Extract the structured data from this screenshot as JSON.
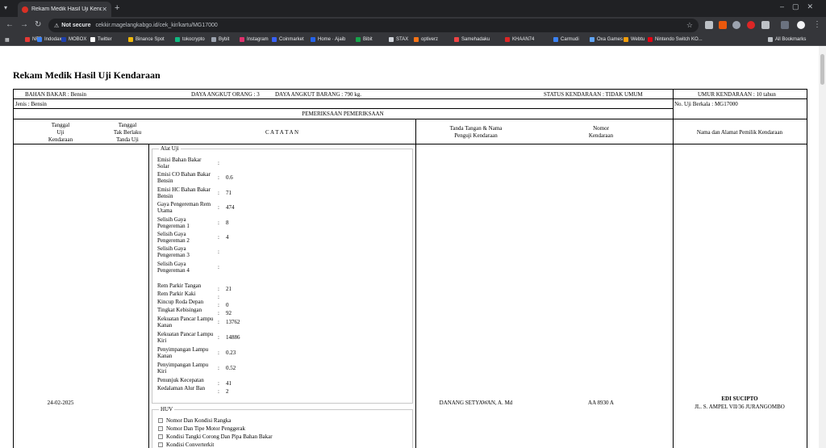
{
  "browser": {
    "tab_title": "Rekam Medik Hasil Uji Kendaraa",
    "not_secure": "Not secure",
    "url": "cekkir.magelangkabgo.id/cek_kir/kartu/MG17000",
    "bookmarks": [
      "NFD",
      "Indodax",
      "MOBOX",
      "Twitter",
      "Binance Spot",
      "tokocrypto",
      "Bybit",
      "Instagram",
      "Coinmarket",
      "Home · Ajaib",
      "Bibit",
      "STAX",
      "optiverz",
      "Samehadaku",
      "KHAAN74",
      "Carmudi",
      "Oxa Games",
      "Webtu",
      "Nintendo Switch KO...",
      "All Bookmarks"
    ],
    "bookmark_colors": [
      "#e53935",
      "#3b82f6",
      "#1e40af",
      "#ffffff",
      "#f0b90b",
      "#10b981",
      "#9ca3af",
      "#e1306c",
      "#3861fb",
      "#2563eb",
      "#16a34a",
      "#d1d5db",
      "#f97316",
      "#ef4444",
      "#dc2626",
      "#3b82f6",
      "#60a5fa",
      "#f59e0b",
      "#e60012",
      "#bdc1c6"
    ]
  },
  "doc": {
    "title": "Rekam Medik Hasil Uji Kendaraan",
    "bahan_bakar": "BAHAN BAKAR : Bensin",
    "daya_orang": "DAYA ANGKUT ORANG : 3",
    "daya_barang": "DAYA ANGKUT BARANG : 790 kg.",
    "status": "STATUS KENDARAAN : TIDAK UMUM",
    "umur": "UMUR KENDARAAN : 10 tahun",
    "jenis": "Jenis : Bensin",
    "no_uji": "No. Uji Berkala : MG17000",
    "pemeriksaan": "PEMERIKSAAN PEMERIKSAAN",
    "col_tanggal": [
      "Tanggal",
      "Uji",
      "Kendaraan"
    ],
    "col_tak_berlaku": [
      "Tanggal",
      "Tak Berlaku",
      "Tanda Uji"
    ],
    "col_catatan": "C A T A T A N",
    "col_tanda_tangan": [
      "Tanda Tangan & Nama",
      "Penguji Kendaraan"
    ],
    "col_nomor": [
      "Nomor",
      "Kendaraan"
    ],
    "col_nama_alamat": "Nama dan Alamat Pemilik Kendaraan",
    "alat_uji_legend": "Alat Uji",
    "measurements": [
      {
        "label": "Emisi Bahan Bakar Solar",
        "value": ""
      },
      {
        "label": "Emisi CO Bahan Bakar Bensin",
        "value": "0.6"
      },
      {
        "label": "Emisi HC Bahan Bakar Bensin",
        "value": "71"
      },
      {
        "label": "Gaya Pengereman Rem Utama",
        "value": "474"
      },
      {
        "label": "Selisih Gaya Pengereman 1",
        "value": "8"
      },
      {
        "label": "Selisih Gaya Pengereman 2",
        "value": "4"
      },
      {
        "label": "Selisih Gaya Pengereman 3",
        "value": ""
      },
      {
        "label": "Selisih Gaya Pengereman 4",
        "value": ""
      },
      {
        "label": "Rem Parkir Tangan",
        "value": "21"
      },
      {
        "label": "Rem Parkir Kaki",
        "value": ""
      },
      {
        "label": "Kincup Roda Depan",
        "value": "0"
      },
      {
        "label": "Tingkat Kebisingan",
        "value": "92"
      },
      {
        "label": "Kekuatan Pancar Lampu Kanan",
        "value": "13762"
      },
      {
        "label": "Kekuatan Pancar Lampu Kiri",
        "value": "14886"
      },
      {
        "label": "Penyimpangan Lampu Kanan",
        "value": "0.23"
      },
      {
        "label": "Penyimpangan Lampu Kiri",
        "value": "0.52"
      },
      {
        "label": "Penunjuk Kecepatan",
        "value": "41"
      },
      {
        "label": "Kedalaman Alur Ban",
        "value": "2"
      }
    ],
    "huv_legend": "HUV",
    "huv_items": [
      "Nomor Dan Kondisi Rangka",
      "Nomor Dan Tipe Motor Penggerak",
      "Kondisi Tangki Corong Dan Pipa Bahan Bakar",
      "Kondisi Converterkit"
    ],
    "tanggal_uji": "24-02-2025",
    "penguji": "DANANG SETYAWAN, A. Md",
    "nomor_kendaraan": "AA 8930 A",
    "pemilik_nama": "EDI SUCIPTO",
    "pemilik_alamat": "JL. S. AMPEL VII/36 JURANGOMBO"
  }
}
